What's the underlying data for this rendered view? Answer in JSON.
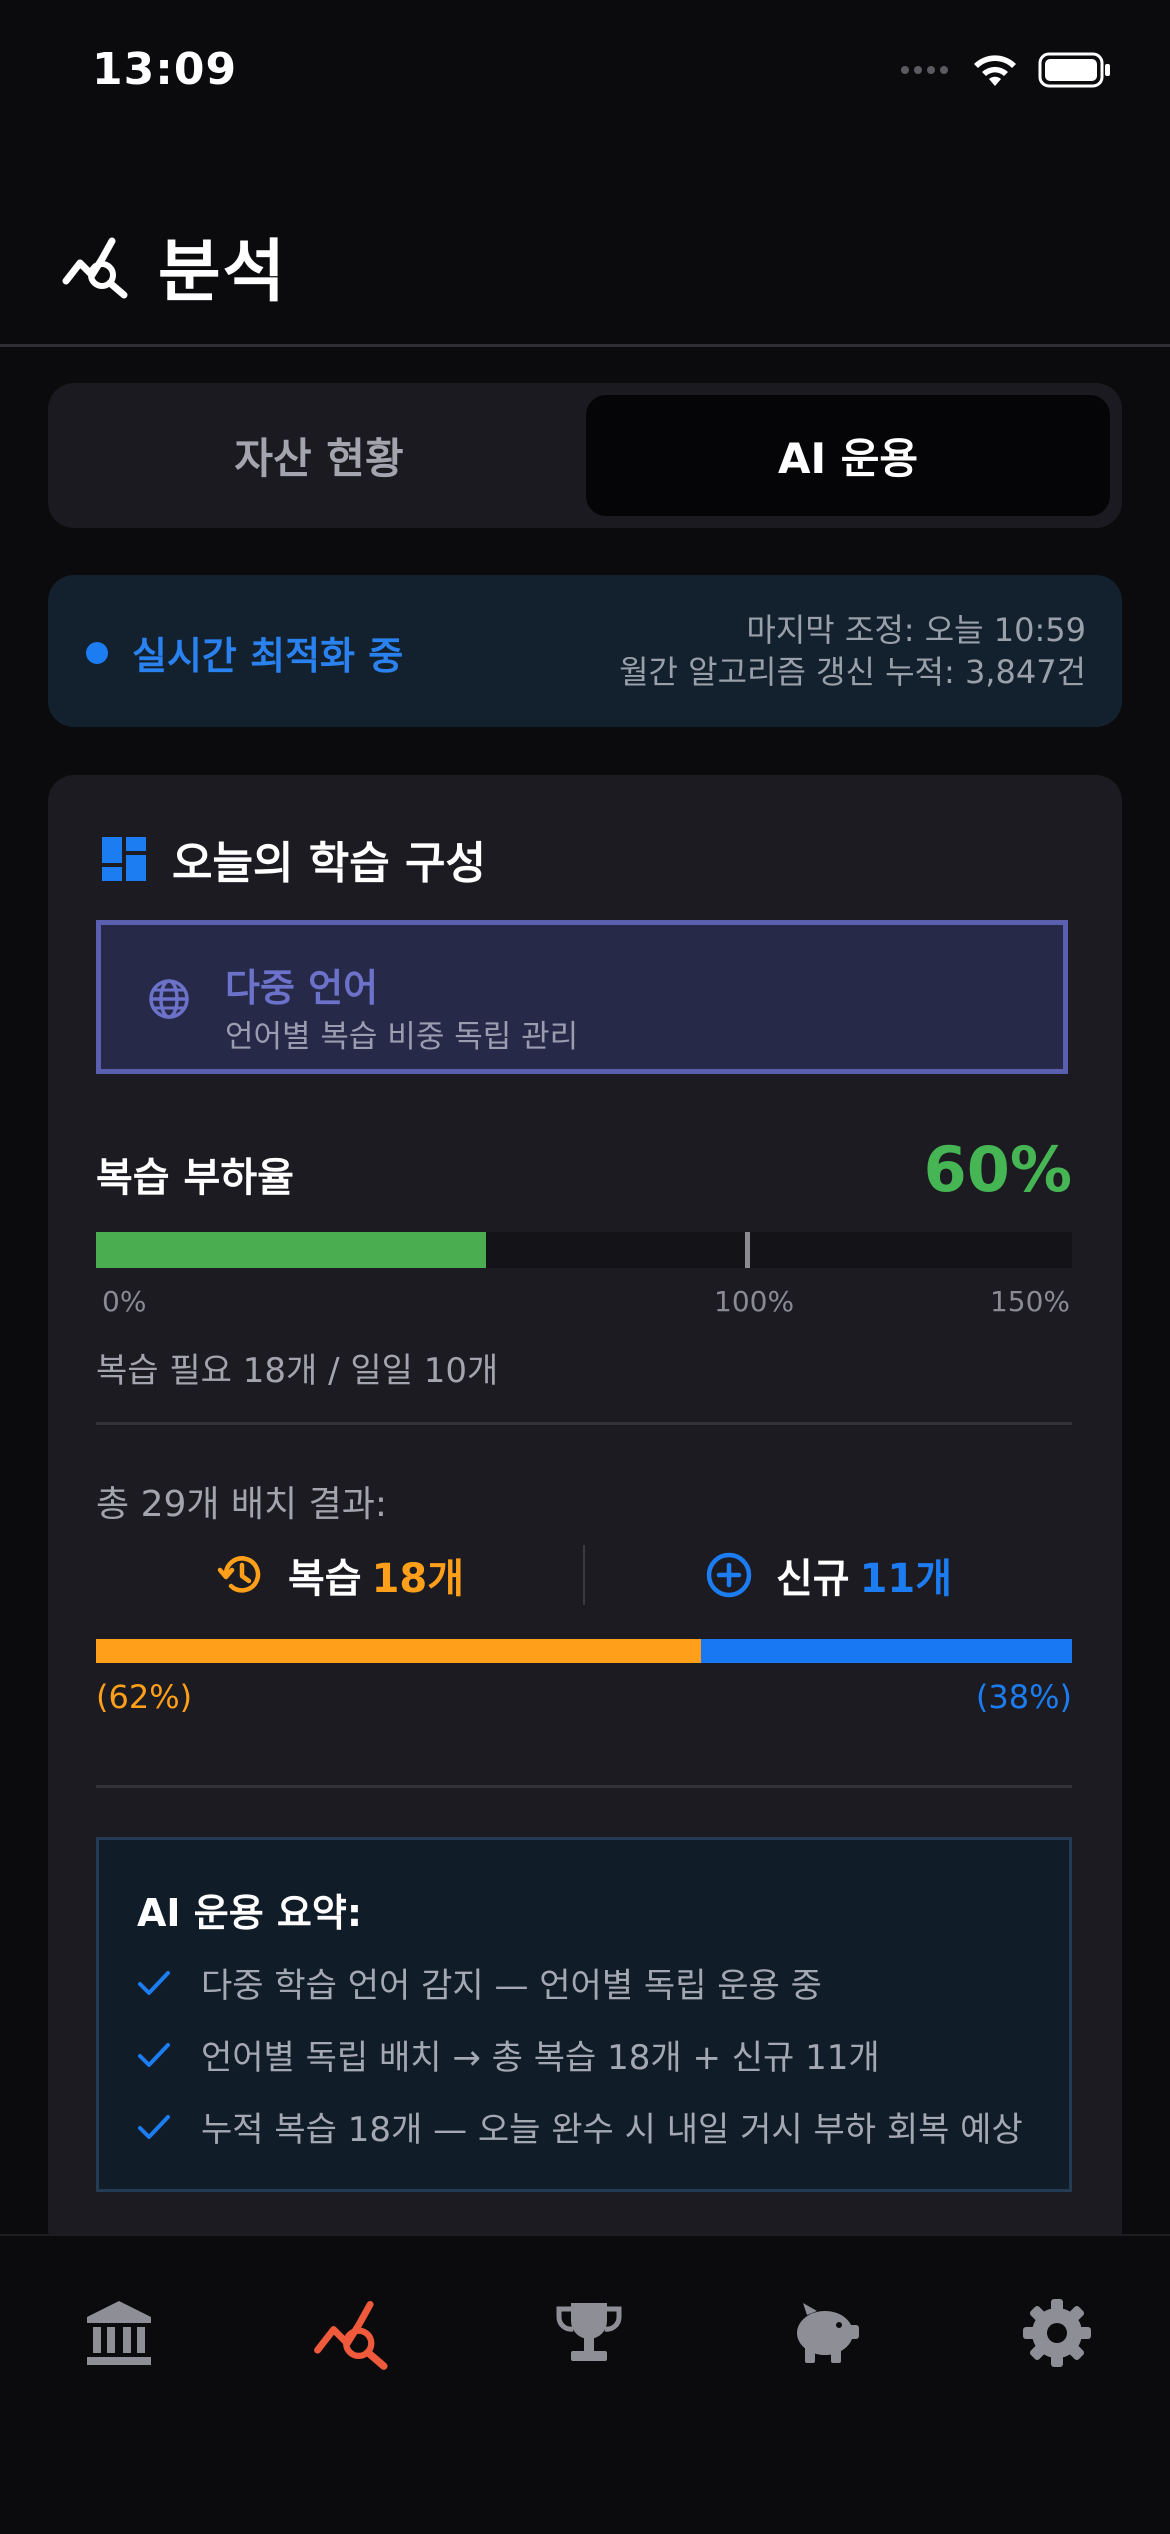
{
  "status_bar": {
    "time": "13:09"
  },
  "header": {
    "title": "분석",
    "icon": "analytics-icon"
  },
  "segment": {
    "tabs": [
      {
        "label": "자산 현황",
        "selected": false
      },
      {
        "label": "AI 운용",
        "selected": true
      }
    ]
  },
  "status_card": {
    "status_text": "실시간 최적화 중",
    "last_adjust": "마지막 조정: 오늘 10:59",
    "monthly_updates": "월간 알고리즘 갱신 누적: 3,847건"
  },
  "composition": {
    "title": "오늘의 학습 구성",
    "language_box": {
      "title": "다중 언어",
      "subtitle": "언어별 복습 비중 독립 관리",
      "icon": "globe-icon"
    },
    "load": {
      "label": "복습 부하율",
      "value_text": "60%",
      "value": 60,
      "scale_max": 150,
      "marker": 100,
      "ticks": [
        "0%",
        "100%",
        "150%"
      ],
      "detail": "복습 필요 18개 / 일일 10개"
    },
    "split": {
      "total_label": "총 29개 배치 결과:",
      "review_label": "복습",
      "review_count": "18개",
      "new_label": "신규",
      "new_count": "11개",
      "review_fraction": 0.62,
      "review_pct": "(62%)",
      "new_pct": "(38%)"
    },
    "summary": {
      "title": "AI 운용 요약:",
      "items": [
        "다중 학습 언어 감지 — 언어별 독립 운용 중",
        "언어별 독립 배치 → 총 복습 18개 + 신규 11개",
        "누적 복습 18개 — 오늘 완수 시 내일 거시 부하 회복 예상"
      ]
    }
  },
  "tabbar": {
    "items": [
      {
        "icon": "bank-icon",
        "active": false
      },
      {
        "icon": "analytics-icon",
        "active": true
      },
      {
        "icon": "trophy-icon",
        "active": false
      },
      {
        "icon": "piggy-bank-icon",
        "active": false
      },
      {
        "icon": "gear-icon",
        "active": false
      }
    ]
  },
  "colors": {
    "accent_blue": "#1c7cf2",
    "green": "#4aad4f",
    "orange": "#ff9f1a",
    "active_tab": "#f05a3c",
    "inactive_tab": "#8e8e96"
  }
}
